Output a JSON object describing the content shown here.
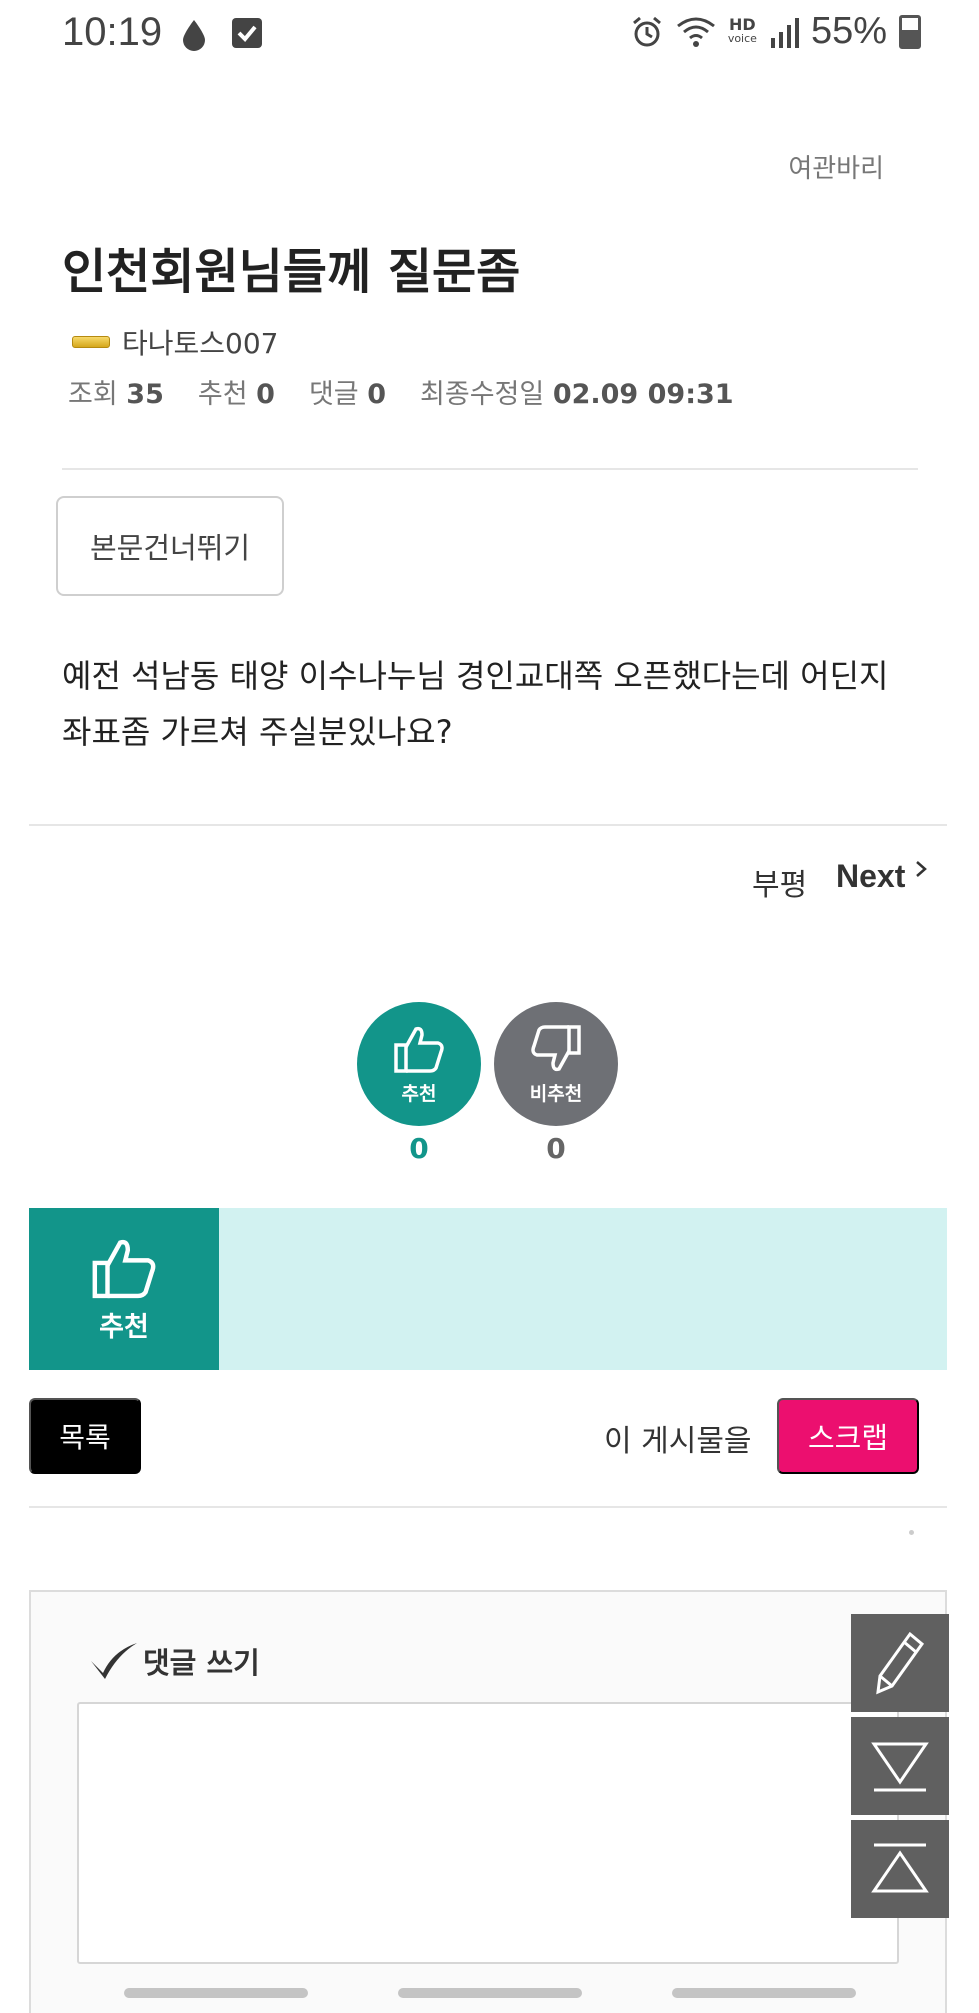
{
  "status_bar": {
    "time": "10:19",
    "hd_label": "HD",
    "hd_sub": "voice",
    "battery": "55%",
    "icons": [
      "drop-icon",
      "checkbox-icon",
      "alarm-icon",
      "wifi-icon",
      "signal-icon",
      "battery-icon"
    ]
  },
  "board": {
    "name": "여관바리"
  },
  "post": {
    "title": "인천회원님들께 질문좀",
    "author": "타나토스007",
    "meta": {
      "views_label": "조회",
      "views": "35",
      "recommend_label": "추천",
      "recommend": "0",
      "comments_label": "댓글",
      "comments": "0",
      "modified_label": "최종수정일",
      "modified": "02.09 09:31"
    },
    "skip_button": "본문건너뛰기",
    "body": "예전 석남동 태양 이수나누님 경인교대쪽 오픈했다는데 어딘지 좌표좀 가르쳐 주실분있나요?"
  },
  "navigation": {
    "prev": "부평",
    "next": "Next"
  },
  "votes": {
    "up_label": "추천",
    "up_count": "0",
    "down_label": "비추천",
    "down_count": "0"
  },
  "recommend_banner": {
    "label": "추천"
  },
  "actions": {
    "list_button": "목록",
    "scrap_prefix": "이 게시물을",
    "scrap_button": "스크랩"
  },
  "comment": {
    "heading": "댓글 쓰기",
    "placeholder": ""
  },
  "floating_buttons": [
    "pencil-icon",
    "scroll-down-icon",
    "scroll-up-icon"
  ],
  "colors": {
    "accent": "#12958a",
    "scrap": "#ec0f6f",
    "banner_bg": "#d2f2f1",
    "dislike": "#6e7075"
  }
}
